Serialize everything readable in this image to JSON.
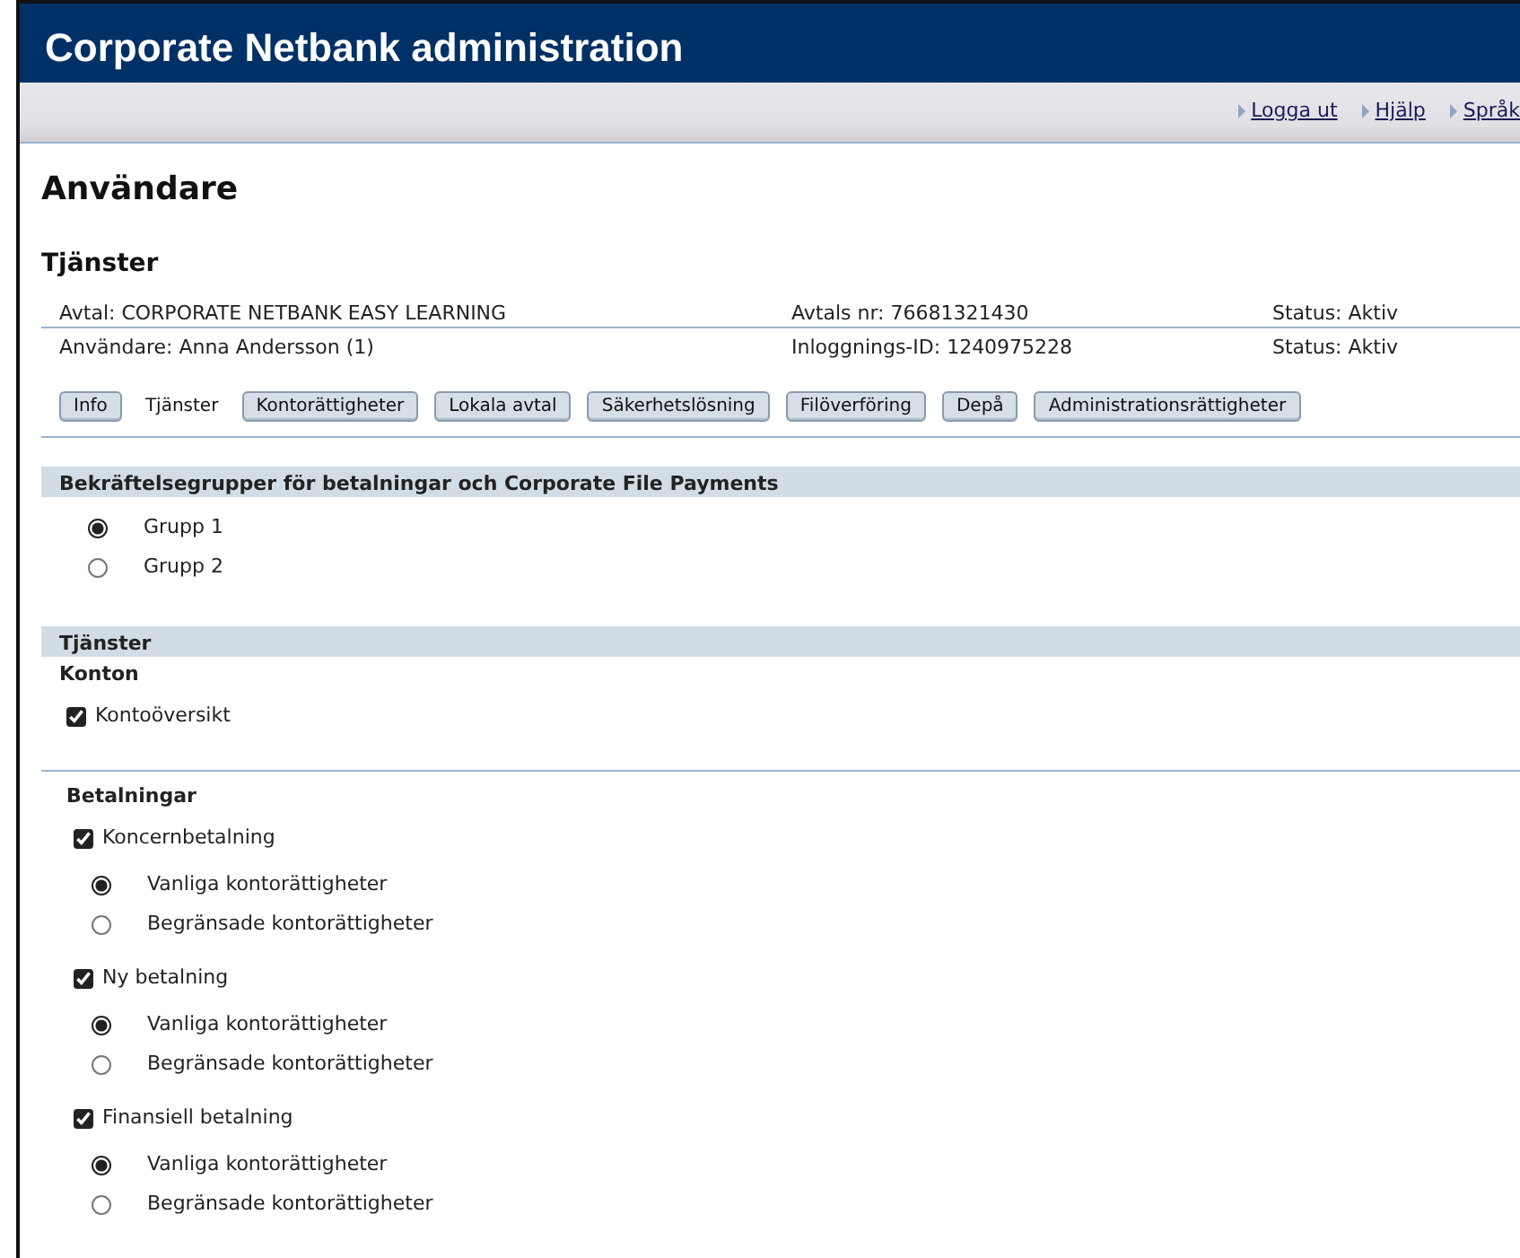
{
  "header": {
    "title": "Corporate Netbank administration"
  },
  "top_links": [
    {
      "label": "Logga ut"
    },
    {
      "label": "Hjälp"
    },
    {
      "label": "Språk"
    }
  ],
  "page_title": "Användare",
  "section_title": "Tjänster",
  "info_rows": [
    {
      "left": "Avtal: CORPORATE NETBANK EASY LEARNING",
      "middle": "Avtals nr: 76681321430",
      "right": "Status: Aktiv"
    },
    {
      "left": "Användare: Anna Andersson (1)",
      "middle": "Inloggnings-ID: 1240975228",
      "right": "Status: Aktiv"
    }
  ],
  "tabs": [
    {
      "label": "Info",
      "selected": false
    },
    {
      "label": "Tjänster",
      "selected": true
    },
    {
      "label": "Kontorättigheter",
      "selected": false
    },
    {
      "label": "Lokala avtal",
      "selected": false
    },
    {
      "label": "Säkerhetslösning",
      "selected": false
    },
    {
      "label": "Filöverföring",
      "selected": false
    },
    {
      "label": "Depå",
      "selected": false
    },
    {
      "label": "Administrationsrättigheter",
      "selected": false
    }
  ],
  "approval_groups": {
    "title": "Bekräftelsegrupper för betalningar och Corporate File Payments",
    "options": [
      {
        "label": "Grupp 1",
        "selected": true
      },
      {
        "label": "Grupp 2",
        "selected": false
      }
    ]
  },
  "services": {
    "title": "Tjänster",
    "subsections": [
      {
        "title": "Konton",
        "items": [
          {
            "label": "Kontoöversikt",
            "checked": true
          }
        ]
      },
      {
        "title": "Betalningar",
        "items": [
          {
            "label": "Koncernbetalning",
            "checked": true,
            "options": [
              {
                "label": "Vanliga kontorättigheter",
                "selected": true
              },
              {
                "label": "Begränsade kontorättigheter",
                "selected": false
              }
            ]
          },
          {
            "label": "Ny betalning",
            "checked": true,
            "options": [
              {
                "label": "Vanliga kontorättigheter",
                "selected": true
              },
              {
                "label": "Begränsade kontorättigheter",
                "selected": false
              }
            ]
          },
          {
            "label": "Finansiell betalning",
            "checked": true,
            "options": [
              {
                "label": "Vanliga kontorättigheter",
                "selected": true
              },
              {
                "label": "Begränsade kontorättigheter",
                "selected": false
              }
            ]
          }
        ]
      }
    ]
  }
}
